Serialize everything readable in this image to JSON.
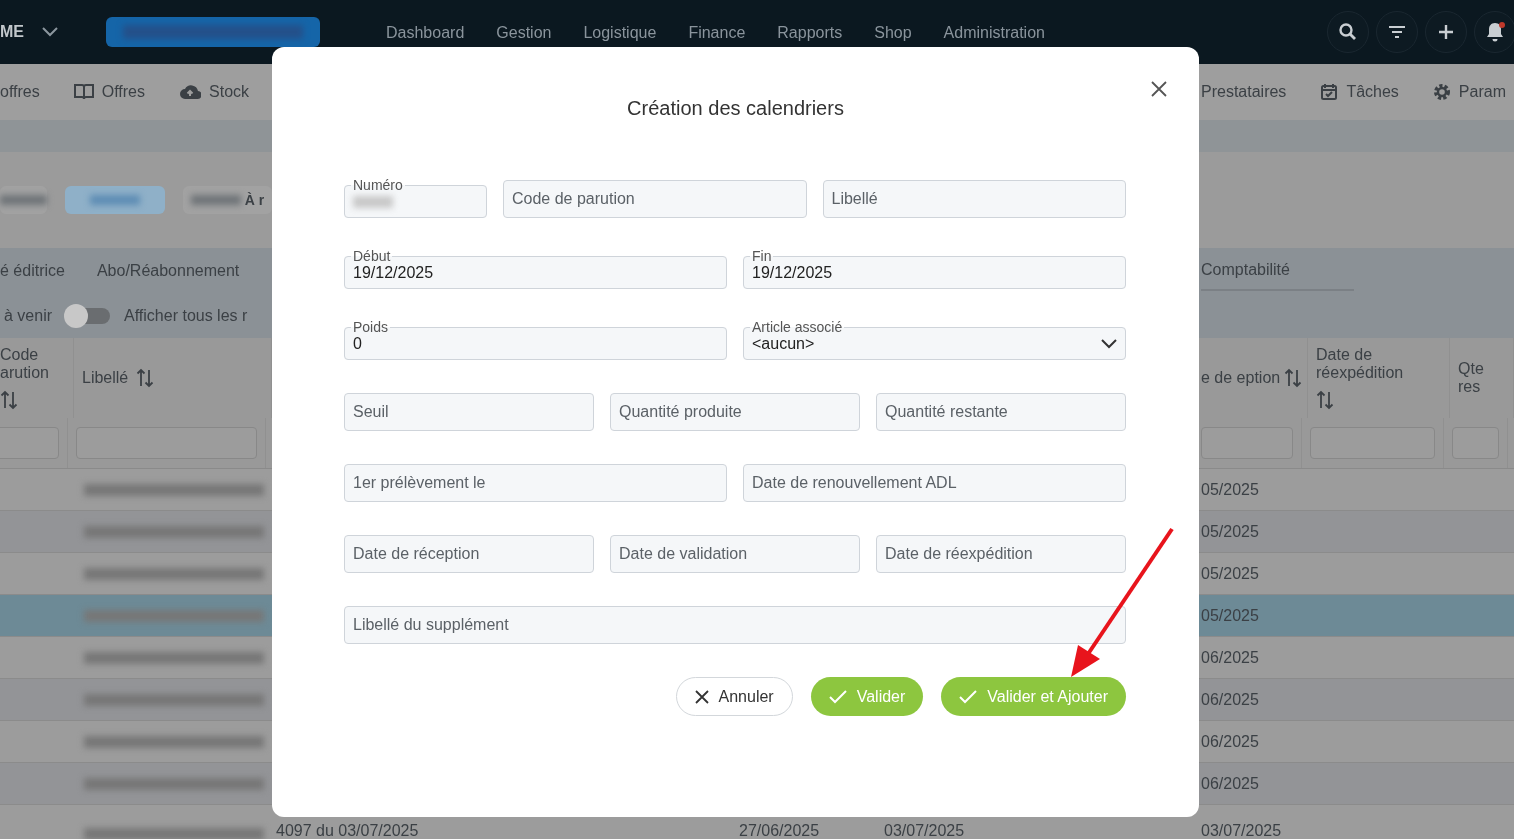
{
  "topbar": {
    "brand": "ME",
    "nav": [
      "Dashboard",
      "Gestion",
      "Logistique",
      "Finance",
      "Rapports",
      "Shop",
      "Administration"
    ],
    "actions": [
      {
        "kind": "search"
      },
      {
        "kind": "filter"
      },
      {
        "kind": "add"
      },
      {
        "kind": "bell",
        "unread": true
      }
    ]
  },
  "toolbar": {
    "left": [
      {
        "kind": "none",
        "label": "offres"
      },
      {
        "kind": "book",
        "label": "Offres"
      },
      {
        "kind": "cloud",
        "label": "Stock"
      }
    ],
    "right": [
      {
        "kind": "none",
        "label": "Prestataires"
      },
      {
        "kind": "calendar",
        "label": "Tâches"
      },
      {
        "kind": "gear",
        "label": "Param"
      }
    ]
  },
  "chips": [
    {
      "selected": false
    },
    {
      "selected": true
    },
    {
      "selected": false,
      "label": "À r"
    }
  ],
  "tabs": [
    {
      "label": "é éditrice",
      "selected": false
    },
    {
      "label": "Abo/Réabonnement",
      "selected": false
    },
    {
      "label": "Comptabilité",
      "selected": true
    }
  ],
  "filters": {
    "label": "à venir",
    "toggle": {
      "on": false,
      "label": "Afficher tous les r"
    }
  },
  "table": {
    "columns": [
      "Code arution",
      "Libellé",
      "",
      "",
      "",
      "e de eption",
      "Date de réexpédition",
      "Qte res"
    ],
    "rows": [
      {
        "selected": false,
        "cells": [
          "",
          "",
          "",
          "",
          "",
          "05/2025",
          "",
          ""
        ]
      },
      {
        "selected": false,
        "cells": [
          "",
          "",
          "",
          "",
          "",
          "05/2025",
          "",
          ""
        ]
      },
      {
        "selected": false,
        "cells": [
          "",
          "",
          "",
          "",
          "",
          "05/2025",
          "",
          ""
        ]
      },
      {
        "selected": true,
        "cells": [
          "",
          "",
          "",
          "",
          "",
          "05/2025",
          "",
          ""
        ]
      },
      {
        "selected": false,
        "cells": [
          "",
          "",
          "",
          "",
          "",
          "06/2025",
          "",
          ""
        ]
      },
      {
        "selected": false,
        "cells": [
          "",
          "",
          "",
          "",
          "",
          "06/2025",
          "",
          ""
        ]
      },
      {
        "selected": false,
        "cells": [
          "",
          "",
          "",
          "",
          "",
          "06/2025",
          "",
          ""
        ]
      },
      {
        "selected": false,
        "cells": [
          "",
          "",
          "",
          "",
          "",
          "06/2025",
          "",
          ""
        ]
      },
      {
        "selected": false,
        "cells": [
          "",
          "",
          "4097 du 03/07/2025",
          "27/06/2025",
          "03/07/2025",
          "03/07/2025",
          "",
          ""
        ]
      }
    ]
  },
  "modal": {
    "title": "Création des calendriers",
    "rows": [
      [
        {
          "kind": "blurred",
          "label": "Numéro"
        },
        {
          "kind": "text",
          "placeholder": "Code de parution"
        },
        {
          "kind": "text",
          "placeholder": "Libellé"
        }
      ],
      [
        {
          "kind": "labeled",
          "label": "Début",
          "value": "19/12/2025"
        },
        {
          "kind": "labeled",
          "label": "Fin",
          "value": "19/12/2025"
        }
      ],
      [
        {
          "kind": "labeled",
          "label": "Poids",
          "value": "0"
        },
        {
          "kind": "select",
          "label": "Article associé",
          "value": "<aucun>"
        }
      ],
      [
        {
          "kind": "text",
          "placeholder": "Seuil"
        },
        {
          "kind": "text",
          "placeholder": "Quantité produite"
        },
        {
          "kind": "text",
          "placeholder": "Quantité restante"
        }
      ],
      [
        {
          "kind": "text",
          "placeholder": "1er prélèvement le"
        },
        {
          "kind": "text",
          "placeholder": "Date de renouvellement ADL"
        }
      ],
      [
        {
          "kind": "text",
          "placeholder": "Date de réception"
        },
        {
          "kind": "text",
          "placeholder": "Date de validation"
        },
        {
          "kind": "text",
          "placeholder": "Date de réexpédition"
        }
      ],
      [
        {
          "kind": "text",
          "placeholder": "Libellé du supplément"
        }
      ]
    ],
    "buttons": [
      {
        "kind": "cancel",
        "label": "Annuler"
      },
      {
        "kind": "confirm",
        "label": "Valider"
      },
      {
        "kind": "confirm",
        "label": "Valider et Ajouter"
      }
    ]
  }
}
